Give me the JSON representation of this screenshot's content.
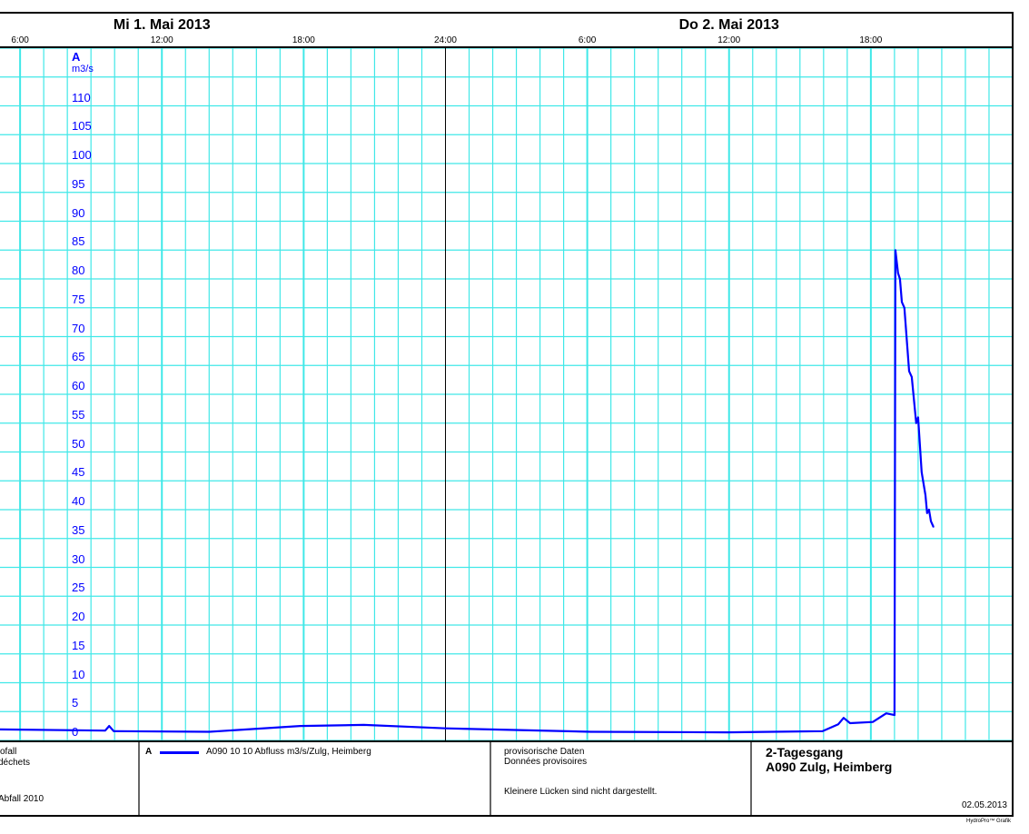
{
  "header": {
    "dates": [
      {
        "label": "Mi  1. Mai  2013",
        "hour": 12
      },
      {
        "label": "Do  2. Mai  2013",
        "hour": 36
      }
    ],
    "time_ticks": [
      {
        "label": "6:00",
        "hour": 6
      },
      {
        "label": "12:00",
        "hour": 12
      },
      {
        "label": "18:00",
        "hour": 18
      },
      {
        "label": "24:00",
        "hour": 24
      },
      {
        "label": "6:00",
        "hour": 30
      },
      {
        "label": "12:00",
        "hour": 36
      },
      {
        "label": "18:00",
        "hour": 42
      }
    ]
  },
  "axis": {
    "series_letter": "A",
    "unit": "m3/s"
  },
  "footer": {
    "left_lines": [
      "ofall",
      " déchets",
      " Abfall 2010"
    ],
    "legend_letter": "A",
    "legend_label": "A090 10 10  Abfluss m3/s/Zulg, Heimberg",
    "notes": [
      "provisorische Daten",
      "Données provisoires",
      "Kleinere Lücken sind nicht dargestellt."
    ],
    "title": "2-Tagesgang",
    "station": "A090 Zulg, Heimberg",
    "date": "02.05.2013",
    "credit": "HydroPro™ Grafik"
  },
  "colors": {
    "grid": "#40e8e8",
    "line": "#0000ff",
    "axis_text": "#0000ff"
  },
  "chart_data": {
    "type": "line",
    "title": "2-Tagesgang A090 Zulg, Heimberg",
    "xlabel": "",
    "ylabel": "m3/s",
    "xlim": [
      5.15,
      48
    ],
    "ylim": [
      0,
      120
    ],
    "yticks": [
      0,
      5,
      10,
      15,
      20,
      25,
      30,
      35,
      40,
      45,
      50,
      55,
      60,
      65,
      70,
      75,
      80,
      85,
      90,
      95,
      100,
      105,
      110
    ],
    "grid": true,
    "legend": "bottom",
    "series": [
      {
        "name": "A090 10 10  Abfluss m3/s/Zulg, Heimberg",
        "x": [
          5.15,
          9.6,
          9.77,
          9.96,
          14.0,
          17.85,
          20.54,
          24.0,
          30.15,
          35.92,
          39.96,
          40.62,
          40.85,
          41.12,
          42.08,
          42.65,
          43.0,
          43.04,
          43.15,
          43.23,
          43.31,
          43.42,
          43.62,
          43.73,
          43.92,
          44.0,
          44.15,
          44.31,
          44.38,
          44.46,
          44.54,
          44.65
        ],
        "y": [
          1.9,
          1.7,
          2.5,
          1.6,
          1.5,
          2.5,
          2.7,
          2.1,
          1.5,
          1.4,
          1.6,
          2.8,
          3.9,
          3.0,
          3.2,
          4.7,
          4.4,
          85,
          81,
          80,
          76,
          75,
          64,
          63,
          55,
          56,
          46.5,
          42.5,
          39.4,
          40,
          38,
          37
        ]
      }
    ]
  }
}
